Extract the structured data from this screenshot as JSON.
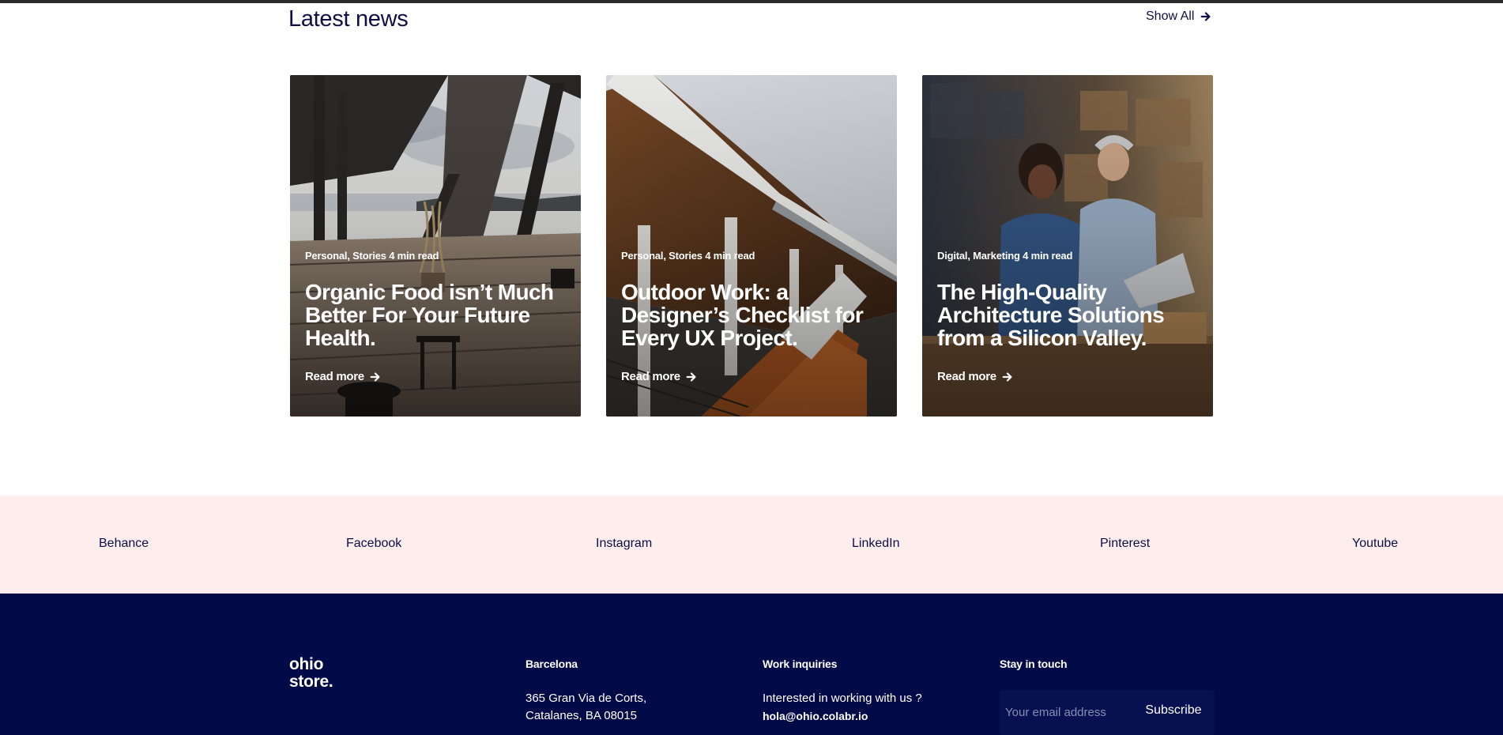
{
  "news": {
    "title": "Latest news",
    "show_all_label": "Show All",
    "cards": [
      {
        "meta": "Personal, Stories 4 min read",
        "title": "Organic Food isn’t Much Better For Your Future Health.",
        "read_more": "Read more"
      },
      {
        "meta": "Personal, Stories 4 min read",
        "title": "Outdoor Work: a Designer’s Checklist for Every UX Project.",
        "read_more": "Read more"
      },
      {
        "meta": "Digital, Marketing 4 min read",
        "title": "The High-Quality Architecture Solutions from a Silicon Valley.",
        "read_more": "Read more"
      }
    ]
  },
  "social": {
    "links": [
      "Behance",
      "Facebook",
      "Instagram",
      "LinkedIn",
      "Pinterest",
      "Youtube"
    ]
  },
  "footer": {
    "logo_line1": "ohio",
    "logo_line2": "store.",
    "barcelona": {
      "heading": "Barcelona",
      "address_line1": "365 Gran Via de Corts,",
      "address_line2": "Catalanes, BA 08015"
    },
    "work": {
      "heading": "Work inquiries",
      "text": "Interested in working with us ?",
      "email": "hola@ohio.colabr.io"
    },
    "stay": {
      "heading": "Stay in touch",
      "email_placeholder": "Your email address",
      "subscribe_label": "Subscribe"
    }
  },
  "colors": {
    "navy": "#020a47",
    "text_dark": "#0c0f45",
    "social_bg": "#fdeeed"
  },
  "icons": {
    "arrow": "arrow-right-icon"
  }
}
